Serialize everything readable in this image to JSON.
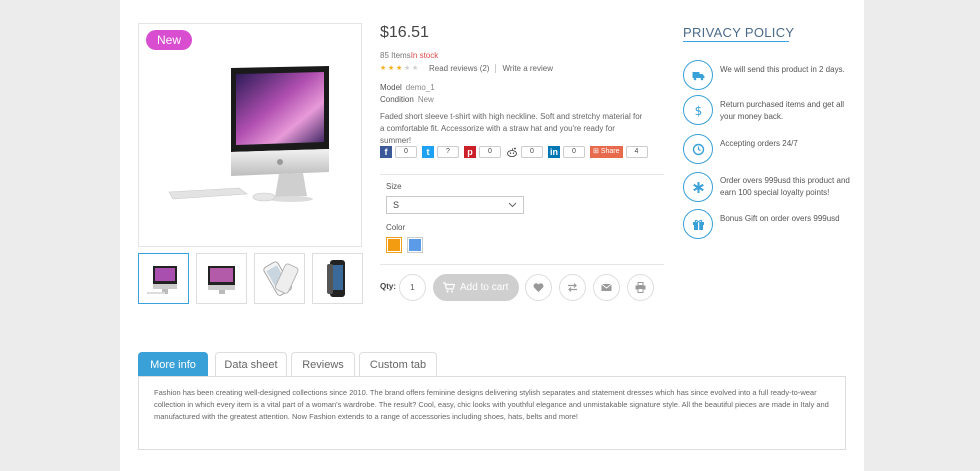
{
  "product": {
    "badge": "New",
    "price": "$16.51",
    "stock_count": "85 Items",
    "stock_status": "In stock",
    "rating": 3,
    "rating_max": 5,
    "read_reviews": "Read reviews (2)",
    "write_review": "Write a review",
    "model_label": "Model",
    "model_value": "demo_1",
    "condition_label": "Condition",
    "condition_value": "New",
    "description": "Faded short sleeve t-shirt with high neckline. Soft and stretchy material for a comfortable fit. Accessorize with a straw hat and you're ready for summer!"
  },
  "share": {
    "facebook_count": "0",
    "twitter_count": "?",
    "pinterest_count": "0",
    "reddit_count": "0",
    "linkedin_count": "0",
    "share_label": "Share",
    "share_count": "4"
  },
  "options": {
    "size_label": "Size",
    "size_selected": "S",
    "color_label": "Color",
    "colors": [
      "#f39c12",
      "#5b9be8"
    ]
  },
  "cart": {
    "qty_label": "Qty:",
    "qty_value": "1",
    "add_label": "Add to cart"
  },
  "privacy": {
    "title": "PRIVACY POLICY",
    "items": [
      {
        "icon": "truck-icon",
        "text": "We will send this product in 2 days."
      },
      {
        "icon": "dollar-icon",
        "text": "Return purchased items and get all your money back."
      },
      {
        "icon": "clock-icon",
        "text": "Accepting orders 24/7"
      },
      {
        "icon": "asterisk-icon",
        "text": "Order overs 999usd this product and earn 100 special loyalty points!"
      },
      {
        "icon": "gift-icon",
        "text": "Bonus Gift on order overs 999usd"
      }
    ]
  },
  "tabs": {
    "items": [
      "More info",
      "Data sheet",
      "Reviews",
      "Custom tab"
    ],
    "active": 0,
    "content": "Fashion has been creating well-designed collections since 2010. The brand offers feminine designs delivering stylish separates and statement dresses which has since evolved into a full ready-to-wear collection in which every item is a vital part of a woman's wardrobe. The result? Cool, easy, chic looks with youthful elegance and unmistakable signature style. All the beautiful pieces are made in Italy and manufactured with the greatest attention. Now Fashion extends to a range of accessories including shoes, hats, belts and more!"
  },
  "colors": {
    "accent": "#3aa0d8",
    "badge": "#d94dd0",
    "in_stock": "#e04a4a"
  }
}
